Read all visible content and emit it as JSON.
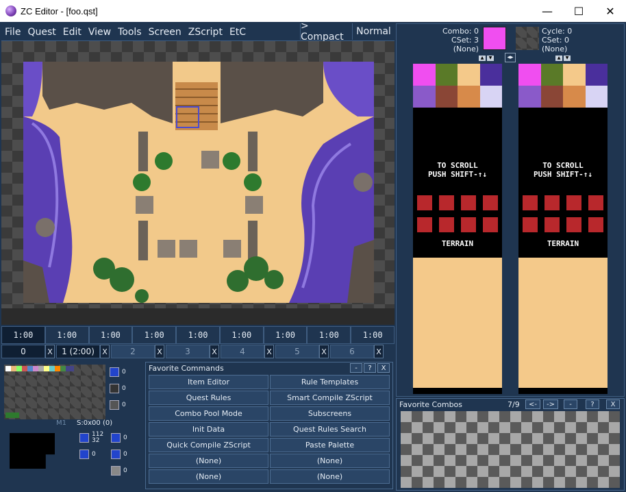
{
  "window": {
    "title": "ZC Editor - [foo.qst]",
    "minimize": "—",
    "maximize": "☐",
    "close": "✕"
  },
  "menu": [
    "File",
    "Quest",
    "Edit",
    "View",
    "Tools",
    "Screen",
    "ZScript",
    "EtC"
  ],
  "compact_label": "> Compact",
  "mode_label": "Normal",
  "screen_tabs": [
    "1:00",
    "1:00",
    "1:00",
    "1:00",
    "1:00",
    "1:00",
    "1:00",
    "1:00",
    "1:00"
  ],
  "layers": [
    {
      "label": "0",
      "x": "X"
    },
    {
      "label": "1 (2:00)",
      "x": "X"
    },
    {
      "label": "2",
      "x": "X"
    },
    {
      "label": "3",
      "x": "X"
    },
    {
      "label": "4",
      "x": "X"
    },
    {
      "label": "5",
      "x": "X"
    },
    {
      "label": "6",
      "x": "X"
    }
  ],
  "combo_info": {
    "combo": "Combo: 0",
    "cset": "CSet: 3",
    "none": "(None)",
    "cycle": "Cycle: 0",
    "cset2": "CSet: 0",
    "none2": "(None)"
  },
  "combo_list_text": {
    "line1": "TO SCROLL",
    "line2": "PUSH SHIFT-↑↓",
    "terrain": "TERRAIN"
  },
  "favorite_commands": {
    "title": "Favorite Commands",
    "buttons": [
      "Item Editor",
      "Rule Templates",
      "Quest Rules",
      "Smart Compile ZScript",
      "Combo Pool Mode",
      "Subscreens",
      "Init Data",
      "Quest Rules Search",
      "Quick Compile ZScript",
      "Paste Palette",
      "(None)",
      "(None)",
      "(None)",
      "(None)"
    ]
  },
  "favorite_combos": {
    "title": "Favorite Combos",
    "count": "7/9",
    "btn_left": "<-",
    "btn_right": "->",
    "btn_minus": "-",
    "btn_help": "?",
    "btn_close": "X"
  },
  "minimap": {
    "map_label": "M1",
    "screen_label": "S:0x00",
    "screen_extra": "(0)"
  },
  "item_counts": {
    "a": "0",
    "b": "0",
    "c": "0",
    "d": "0",
    "e_top": "112",
    "e_bot": "32",
    "f": "0",
    "g": "0",
    "h": "0",
    "i": "0"
  },
  "colors": {
    "accent": "#1f3550",
    "magenta": "#f04ef0",
    "sand": "#f4c98a",
    "water": "#5a3fb3"
  }
}
